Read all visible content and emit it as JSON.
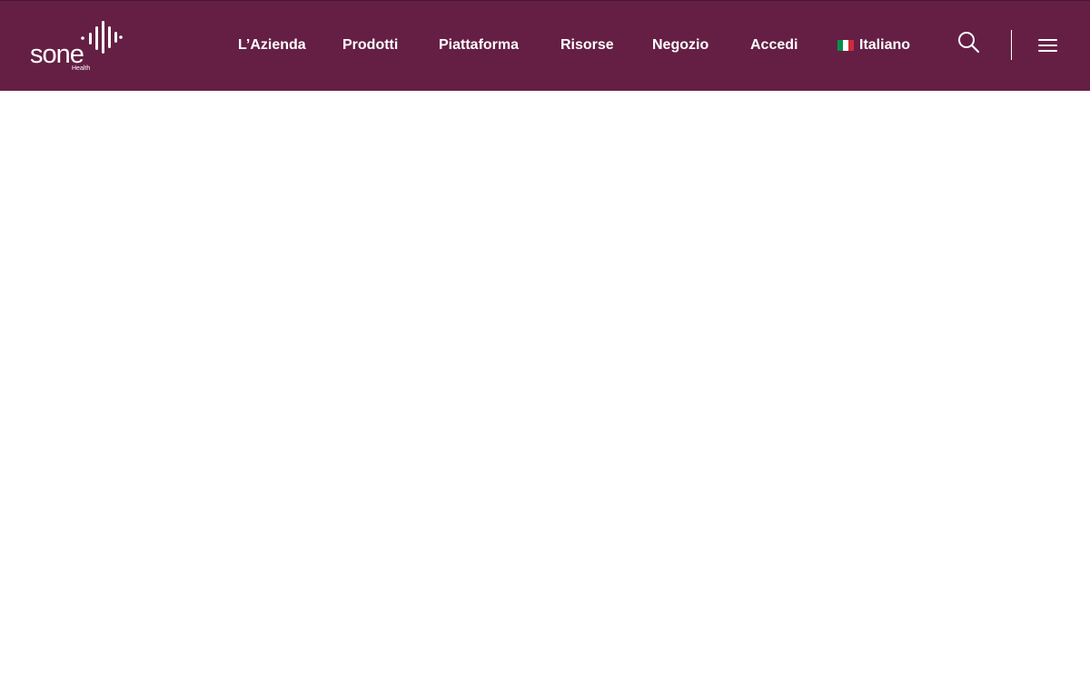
{
  "header": {
    "background_color": "#651f44",
    "logo": {
      "wordmark": "sone",
      "subtitle": "Health"
    },
    "nav": [
      {
        "label": "L’Azienda"
      },
      {
        "label": "Prodotti"
      },
      {
        "label": "Piattaforma"
      },
      {
        "label": "Risorse"
      },
      {
        "label": "Negozio"
      },
      {
        "label": "Accedi"
      }
    ],
    "language": {
      "label": "Italiano",
      "flag_icon": "italy-flag-icon",
      "flag_colors": [
        "#009246",
        "#ffffff",
        "#ce2b37"
      ]
    },
    "search_icon": "search-icon",
    "menu_icon": "hamburger-menu-icon"
  }
}
